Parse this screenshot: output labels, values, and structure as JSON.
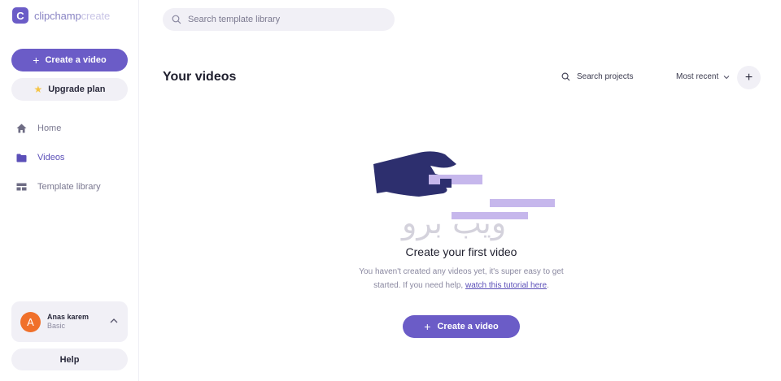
{
  "brand": {
    "logo_letter": "C",
    "name_primary": "clipchamp",
    "name_secondary": "create",
    "accent_color": "#6b5cc7"
  },
  "sidebar": {
    "create_label": "Create a video",
    "upgrade_label": "Upgrade plan",
    "items": [
      {
        "label": "Home",
        "icon": "home-icon",
        "active": false
      },
      {
        "label": "Videos",
        "icon": "folder-icon",
        "active": true
      },
      {
        "label": "Template library",
        "icon": "template-icon",
        "active": false
      }
    ],
    "account": {
      "avatar_letter": "A",
      "name": "Anas karem",
      "plan": "Basic"
    },
    "help_label": "Help"
  },
  "top_search": {
    "placeholder": "Search template library"
  },
  "main": {
    "title": "Your videos",
    "search_projects_label": "Search projects",
    "sort_label": "Most recent",
    "add_label": "+"
  },
  "empty_state": {
    "watermark": "ويب برو",
    "title": "Create your first video",
    "desc_text": "You haven't created any videos yet, it's super easy to get started. If you need help, ",
    "link_text": "watch this tutorial here",
    "desc_end": ".",
    "button_label": "Create a video"
  }
}
